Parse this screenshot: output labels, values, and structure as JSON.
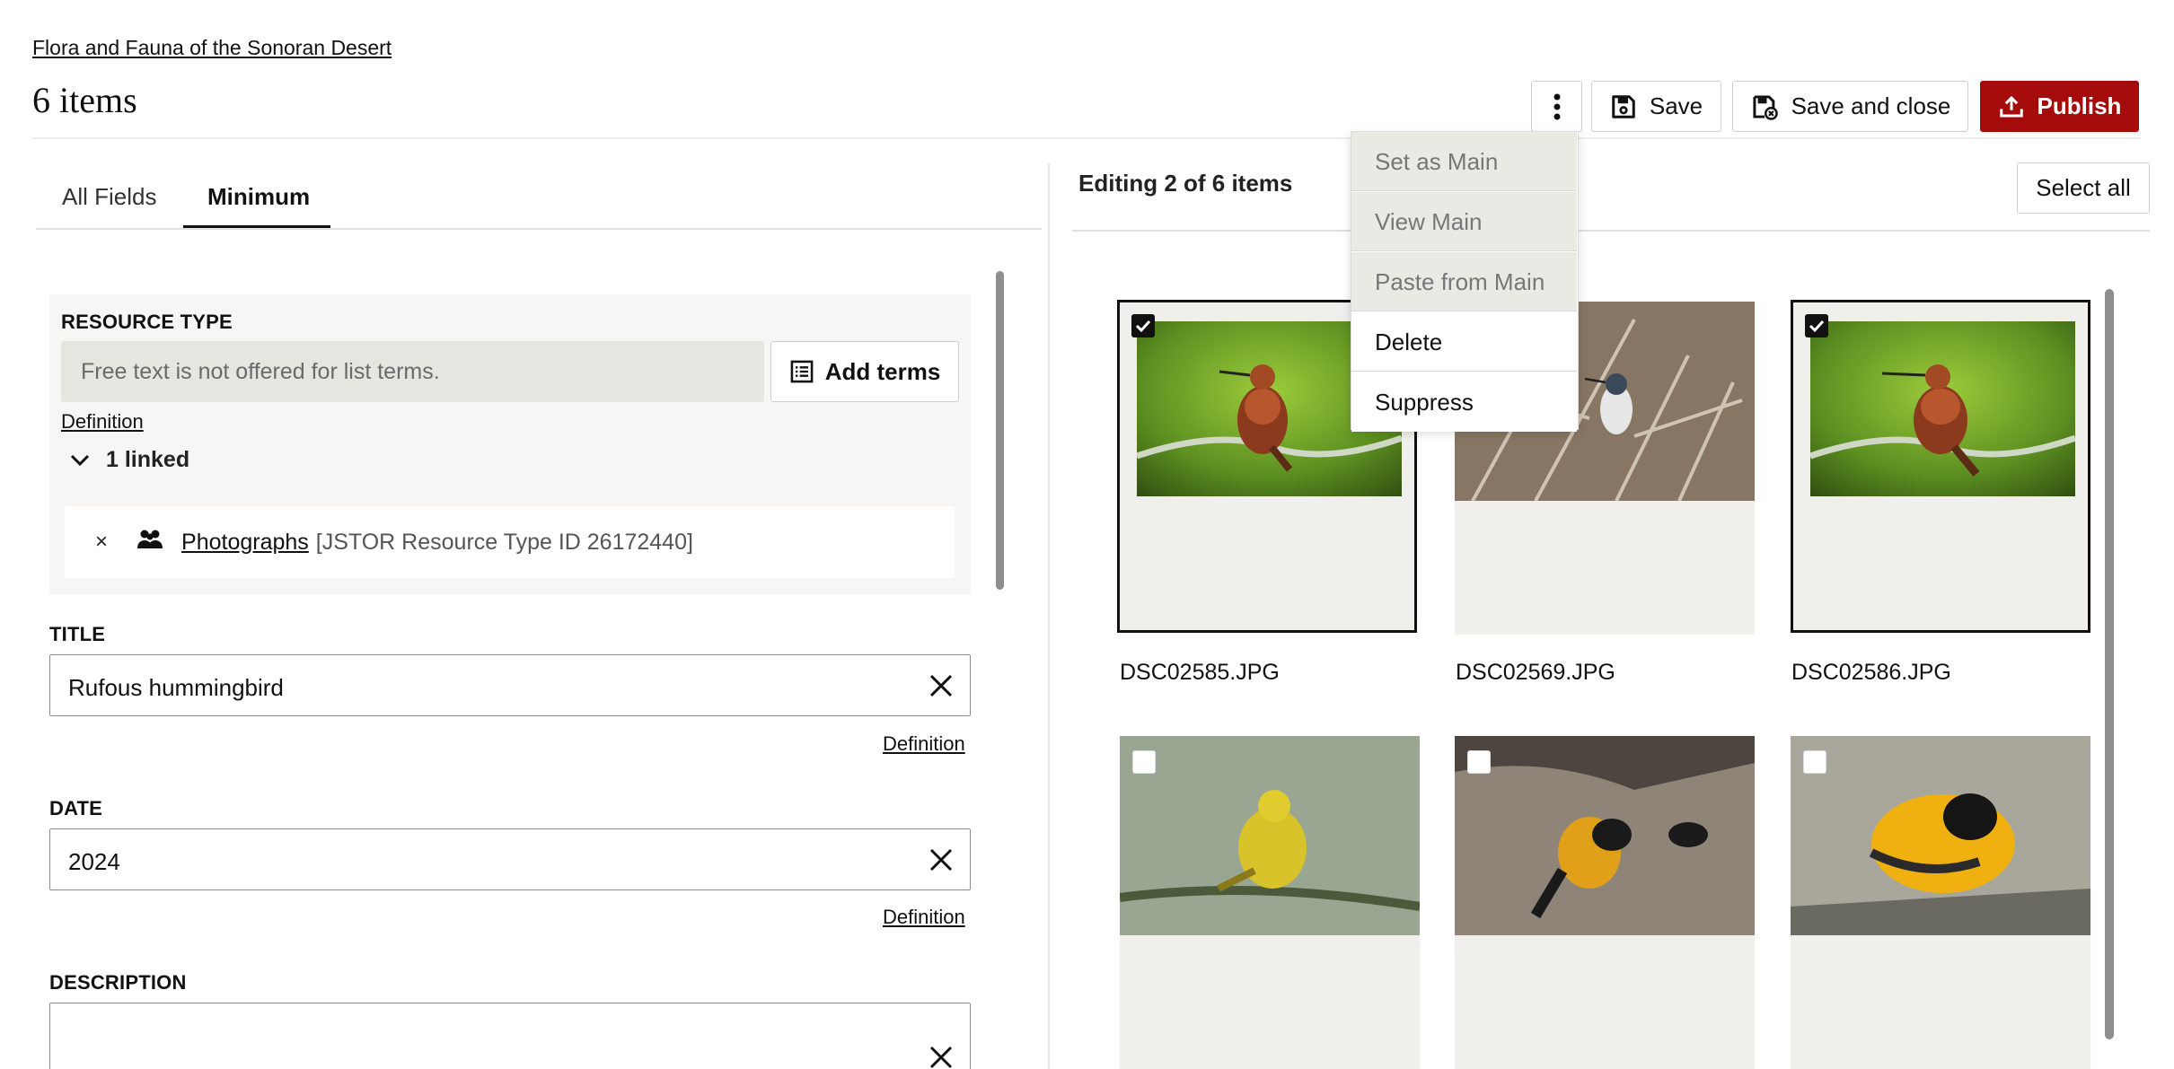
{
  "header": {
    "breadcrumb": "Flora and Fauna of the Sonoran Desert",
    "title": "6 items",
    "actions": {
      "more": "more-options",
      "save": "Save",
      "save_and_close": "Save and close",
      "publish": "Publish"
    },
    "publish_color": "#a50b0b"
  },
  "tabs": [
    {
      "label": "All Fields",
      "active": false
    },
    {
      "label": "Minimum",
      "active": true
    }
  ],
  "form": {
    "resource_type": {
      "label": "RESOURCE TYPE",
      "placeholder": "Free text is not offered for list terms.",
      "add_terms": "Add terms",
      "definition": "Definition",
      "linked_count": "1 linked",
      "linked_items": [
        {
          "remove": "×",
          "name": "Photographs",
          "meta": "[JSTOR Resource Type ID 26172440]"
        }
      ]
    },
    "title": {
      "label": "TITLE",
      "value": "Rufous hummingbird",
      "definition": "Definition"
    },
    "date": {
      "label": "DATE",
      "value": "2024",
      "definition": "Definition"
    },
    "description": {
      "label": "DESCRIPTION",
      "value": ""
    }
  },
  "gallery": {
    "editing_prefix": "Editing ",
    "editing_count": "2 of 6 items",
    "select_all": "Select all",
    "items": [
      {
        "filename": "DSC02585.JPG",
        "checked": true
      },
      {
        "filename": "DSC02569.JPG",
        "checked": false
      },
      {
        "filename": "DSC02586.JPG",
        "checked": true
      },
      {
        "filename": "",
        "checked": false
      },
      {
        "filename": "",
        "checked": false
      },
      {
        "filename": "",
        "checked": false
      }
    ]
  },
  "menu": {
    "items": [
      {
        "label": "Set as Main",
        "disabled": true
      },
      {
        "label": "View Main",
        "disabled": true
      },
      {
        "label": "Paste from Main",
        "disabled": true
      },
      {
        "label": "Delete",
        "disabled": false
      },
      {
        "label": "Suppress",
        "disabled": false
      }
    ]
  }
}
